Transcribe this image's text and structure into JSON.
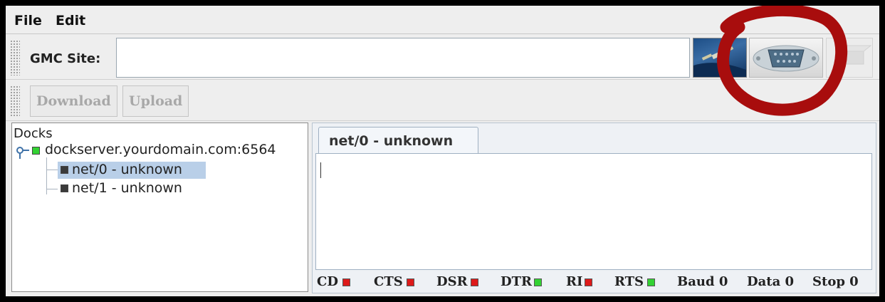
{
  "menu": {
    "file": "File",
    "edit": "Edit"
  },
  "site_toolbar": {
    "label": "GMC Site:",
    "value": ""
  },
  "actions": {
    "download": "Download",
    "upload": "Upload"
  },
  "tree": {
    "root": "Docks",
    "server": "dockserver.yourdomain.com:6564",
    "items": [
      {
        "label": "net/0 - unknown",
        "selected": true
      },
      {
        "label": "net/1 - unknown",
        "selected": false
      }
    ]
  },
  "tab": {
    "label": "net/0 - unknown"
  },
  "status": {
    "cd": "CD",
    "cts": "CTS",
    "dsr": "DSR",
    "dtr": "DTR",
    "ri": "RI",
    "rts": "RTS",
    "baud": "Baud 0",
    "data": "Data 0",
    "stop": "Stop 0"
  },
  "colors": {
    "led_red": "#dd1a1a",
    "led_green": "#33d233",
    "selection": "#b9cfe8",
    "annotation": "#a80d0d"
  },
  "icons": {
    "satellite": "satellite-icon",
    "serial": "serial-port-icon",
    "disabled": "disabled-tool-icon"
  }
}
